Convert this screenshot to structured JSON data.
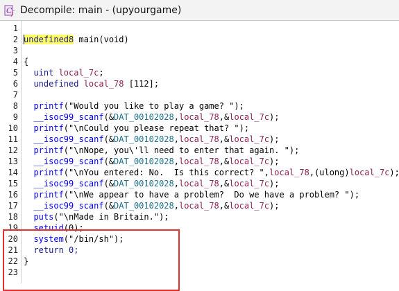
{
  "window": {
    "title": "Decompile: main -  (upyourgame)",
    "icon": "ghidra-decompile-icon"
  },
  "colors": {
    "annotation": "#e03030",
    "highlight": "#ffff66",
    "function": "#0000ff",
    "variable": "#8b2252",
    "data_label": "#1c6e8c"
  },
  "code_lines": [
    {
      "n": "1",
      "tokens": []
    },
    {
      "n": "2",
      "tokens": [
        {
          "t": "undefined8",
          "c": "kw hl"
        },
        {
          "t": " main(void)",
          "c": ""
        }
      ]
    },
    {
      "n": "3",
      "tokens": []
    },
    {
      "n": "4",
      "tokens": [
        {
          "t": "{",
          "c": ""
        }
      ]
    },
    {
      "n": "5",
      "tokens": [
        {
          "t": "  uint ",
          "c": "kw"
        },
        {
          "t": "local_7c",
          "c": "var"
        },
        {
          "t": ";",
          "c": ""
        }
      ]
    },
    {
      "n": "6",
      "tokens": [
        {
          "t": "  undefined ",
          "c": "kw"
        },
        {
          "t": "local_78",
          "c": "var"
        },
        {
          "t": " [112];",
          "c": ""
        }
      ]
    },
    {
      "n": "7",
      "tokens": []
    },
    {
      "n": "8",
      "tokens": [
        {
          "t": "  printf",
          "c": "fn"
        },
        {
          "t": "(\"Would you like to play a game? \");",
          "c": ""
        }
      ]
    },
    {
      "n": "9",
      "tokens": [
        {
          "t": "  __isoc99_scanf",
          "c": "fn"
        },
        {
          "t": "(&",
          "c": ""
        },
        {
          "t": "DAT_00102028",
          "c": "dat"
        },
        {
          "t": ",",
          "c": ""
        },
        {
          "t": "local_78",
          "c": "var"
        },
        {
          "t": ",&",
          "c": ""
        },
        {
          "t": "local_7c",
          "c": "var"
        },
        {
          "t": ");",
          "c": ""
        }
      ]
    },
    {
      "n": "10",
      "tokens": [
        {
          "t": "  printf",
          "c": "fn"
        },
        {
          "t": "(\"\\nCould you please repeat that? \");",
          "c": ""
        }
      ]
    },
    {
      "n": "11",
      "tokens": [
        {
          "t": "  __isoc99_scanf",
          "c": "fn"
        },
        {
          "t": "(&",
          "c": ""
        },
        {
          "t": "DAT_00102028",
          "c": "dat"
        },
        {
          "t": ",",
          "c": ""
        },
        {
          "t": "local_78",
          "c": "var"
        },
        {
          "t": ",&",
          "c": ""
        },
        {
          "t": "local_7c",
          "c": "var"
        },
        {
          "t": ");",
          "c": ""
        }
      ]
    },
    {
      "n": "12",
      "tokens": [
        {
          "t": "  printf",
          "c": "fn"
        },
        {
          "t": "(\"\\nNope, you\\'ll need to enter that again. \");",
          "c": ""
        }
      ]
    },
    {
      "n": "13",
      "tokens": [
        {
          "t": "  __isoc99_scanf",
          "c": "fn"
        },
        {
          "t": "(&",
          "c": ""
        },
        {
          "t": "DAT_00102028",
          "c": "dat"
        },
        {
          "t": ",",
          "c": ""
        },
        {
          "t": "local_78",
          "c": "var"
        },
        {
          "t": ",&",
          "c": ""
        },
        {
          "t": "local_7c",
          "c": "var"
        },
        {
          "t": ");",
          "c": ""
        }
      ]
    },
    {
      "n": "14",
      "tokens": [
        {
          "t": "  printf",
          "c": "fn"
        },
        {
          "t": "(\"\\nYou entered: No.  Is this correct? \",",
          "c": ""
        },
        {
          "t": "local_78",
          "c": "var"
        },
        {
          "t": ",(ulong)",
          "c": ""
        },
        {
          "t": "local_7c",
          "c": "var"
        },
        {
          "t": ");",
          "c": ""
        }
      ]
    },
    {
      "n": "15",
      "tokens": [
        {
          "t": "  __isoc99_scanf",
          "c": "fn"
        },
        {
          "t": "(&",
          "c": ""
        },
        {
          "t": "DAT_00102028",
          "c": "dat"
        },
        {
          "t": ",",
          "c": ""
        },
        {
          "t": "local_78",
          "c": "var"
        },
        {
          "t": ",&",
          "c": ""
        },
        {
          "t": "local_7c",
          "c": "var"
        },
        {
          "t": ");",
          "c": ""
        }
      ]
    },
    {
      "n": "16",
      "tokens": [
        {
          "t": "  printf",
          "c": "fn"
        },
        {
          "t": "(\"\\nWe appear to have a problem?  Do we have a problem? \");",
          "c": ""
        }
      ]
    },
    {
      "n": "17",
      "tokens": [
        {
          "t": "  __isoc99_scanf",
          "c": "fn"
        },
        {
          "t": "(&",
          "c": ""
        },
        {
          "t": "DAT_00102028",
          "c": "dat"
        },
        {
          "t": ",",
          "c": ""
        },
        {
          "t": "local_78",
          "c": "var"
        },
        {
          "t": ",&",
          "c": ""
        },
        {
          "t": "local_7c",
          "c": "var"
        },
        {
          "t": ");",
          "c": ""
        }
      ]
    },
    {
      "n": "18",
      "tokens": [
        {
          "t": "  puts",
          "c": "fn"
        },
        {
          "t": "(\"\\nMade in Britain.\");",
          "c": ""
        }
      ]
    },
    {
      "n": "19",
      "tokens": [
        {
          "t": "  setuid",
          "c": "fn"
        },
        {
          "t": "(0);",
          "c": ""
        }
      ]
    },
    {
      "n": "20",
      "tokens": [
        {
          "t": "  system",
          "c": "fn"
        },
        {
          "t": "(\"/bin/sh\");",
          "c": ""
        }
      ]
    },
    {
      "n": "21",
      "tokens": [
        {
          "t": "  return 0;",
          "c": "kw"
        }
      ]
    },
    {
      "n": "22",
      "tokens": [
        {
          "t": "}",
          "c": ""
        }
      ]
    },
    {
      "n": "23",
      "tokens": []
    }
  ]
}
